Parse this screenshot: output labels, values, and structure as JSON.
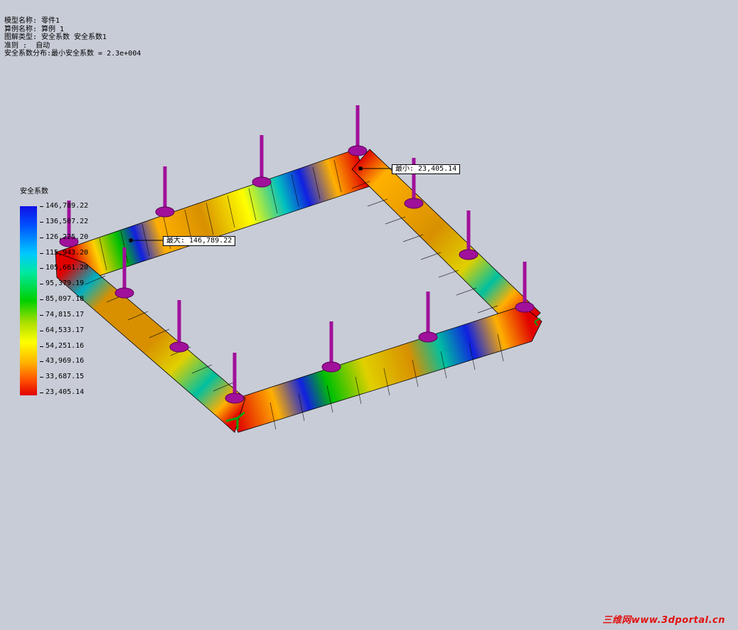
{
  "info": {
    "model_name": "模型名称: 零件1",
    "study_name": "算例名称: 算例 1",
    "plot_type": "图解类型: 安全系数 安全系数1",
    "criterion": "准则 :  自动",
    "distribution": "安全系数分布:最小安全系数 = 2.3e+004"
  },
  "legend": {
    "title": "安全系数",
    "values": [
      "146,789.22",
      "136,507.22",
      "126,225.20",
      "115,943.20",
      "105,661.20",
      "95,379.19",
      "85,097.18",
      "74,815.17",
      "64,533.17",
      "54,251.16",
      "43,969.16",
      "33,687.15",
      "23,405.14"
    ]
  },
  "callouts": {
    "min_label": "最小:  23,405.14",
    "max_label": "最大:  146,789.22"
  },
  "colors": {
    "background": "#c8ccd6",
    "fixture": "#a0109a",
    "max": "#1010e6",
    "min": "#e00000"
  },
  "watermark": "三维网www.3dportal.cn"
}
